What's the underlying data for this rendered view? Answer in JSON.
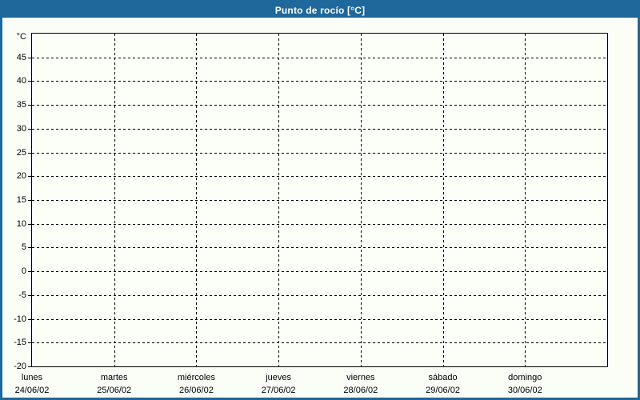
{
  "window": {
    "title": "Punto de rocío [°C]"
  },
  "colors": {
    "accent_blue": "#1e689c",
    "background": "#fbfdf7",
    "grid": "#000000",
    "title_text": "#ffffff"
  },
  "chart_data": {
    "type": "line",
    "title": "Punto de rocío [°C]",
    "y_axis": {
      "unit_label": "°C",
      "min": -20,
      "max": 50,
      "tick_step": 5,
      "ticks": [
        45,
        40,
        35,
        30,
        25,
        20,
        15,
        10,
        5,
        0,
        -5,
        -10,
        -15,
        -20
      ]
    },
    "x_axis": {
      "days": [
        {
          "name": "lunes",
          "date": "24/06/02"
        },
        {
          "name": "martes",
          "date": "25/06/02"
        },
        {
          "name": "miércoles",
          "date": "26/06/02"
        },
        {
          "name": "jueves",
          "date": "27/06/02"
        },
        {
          "name": "viernes",
          "date": "28/06/02"
        },
        {
          "name": "sábado",
          "date": "29/06/02"
        }
      ],
      "last_day": {
        "name": "domingo",
        "date": "30/06/02"
      },
      "divisions": 7
    },
    "grid": true,
    "series": []
  }
}
